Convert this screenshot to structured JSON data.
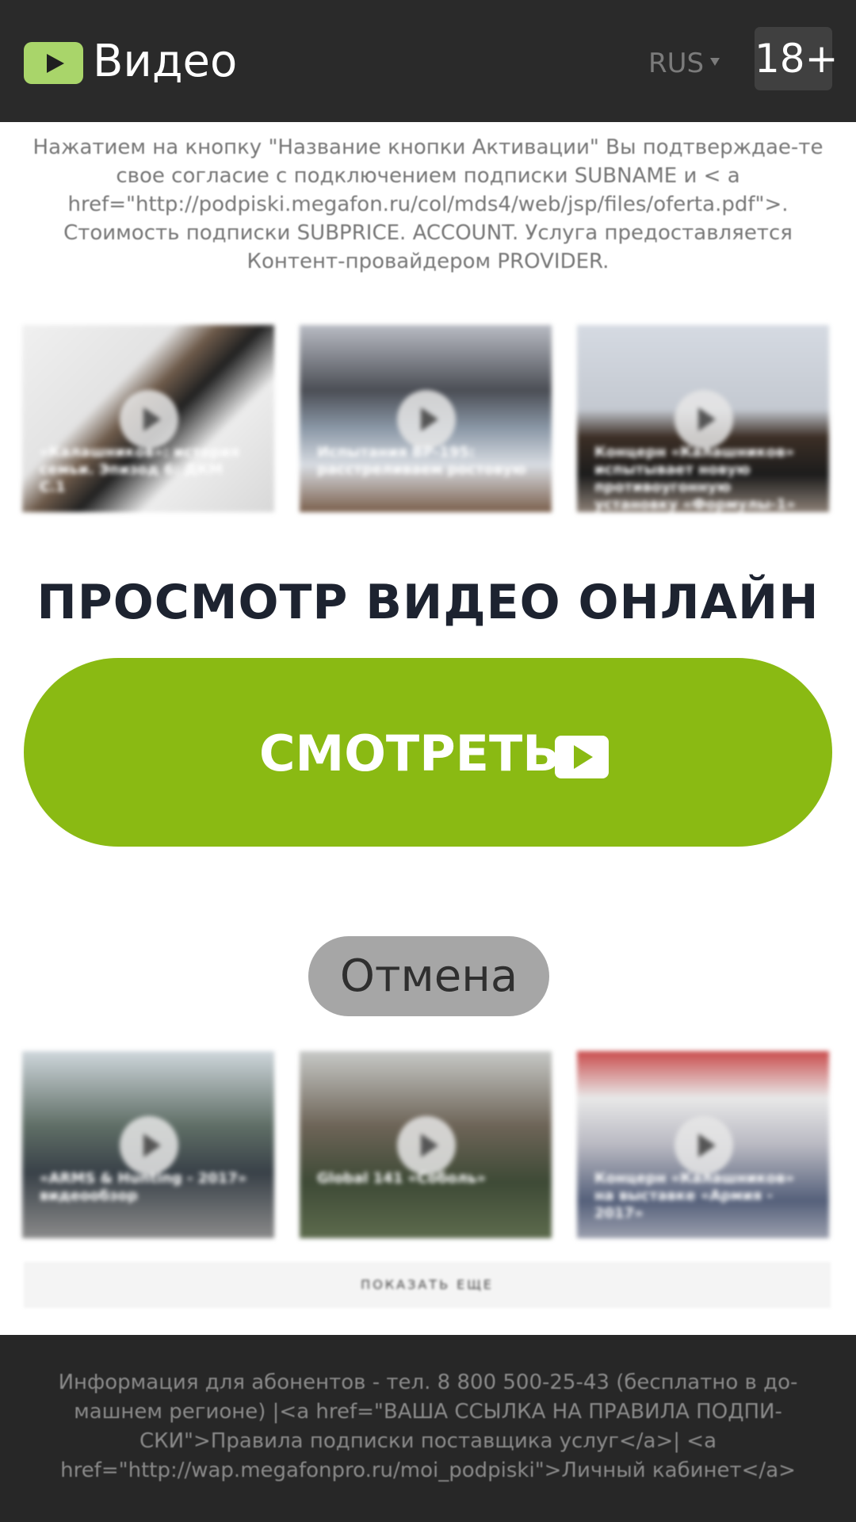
{
  "header": {
    "logo_icon": "play-icon",
    "title": "Видео",
    "language": "RUS",
    "age_badge": "18+"
  },
  "legal": {
    "text": "Нажатием на кнопку \"Название кнопки Активации\" Вы подтверждае-те свое согласие с подключением подписки SUBNAME и < a href=\"http://podpiski.megafon.ru/col/mds4/web/jsp/files/oferta.pdf\">. Стоимость подписки SUBPRICE. ACCOUNT. Услуга предоставляется Контент-провайдером PROVIDER."
  },
  "videos_top": [
    {
      "caption": "«Калашников»: история семьи. Эпизод 6: ДКМ С.1",
      "icon": "play-icon"
    },
    {
      "caption": "Испытания ВР-195: расстреливаем ростовую",
      "icon": "play-icon"
    },
    {
      "caption": "Концерн «Калашников» испытывает новую противоугонную установку «Формулы-1»",
      "icon": "play-icon"
    }
  ],
  "headline": "ПРОСМОТР ВИДЕО ОНЛАЙН",
  "watch_button": {
    "label": "СМОТРЕТЬ",
    "icon": "play-icon",
    "color": "#8aba13"
  },
  "cancel_button": {
    "label": "Отмена"
  },
  "videos_bottom": [
    {
      "caption": "«ARMS & Hunting - 2017» видеообзор",
      "icon": "play-icon"
    },
    {
      "caption": "Global 141 «Соболь»",
      "icon": "play-icon"
    },
    {
      "caption": "Концерн «Калашников» на выставке «Армия - 2017»",
      "icon": "play-icon"
    }
  ],
  "show_more": "ПОКАЗАТЬ ЕЩЕ",
  "footer": {
    "text": "Информация для абонентов - тел. 8 800 500-25-43 (бесплатно в до-машнем регионе) |<a href=\"ВАША ССЫЛКА НА ПРАВИЛА ПОДПИ-СКИ\">Правила подписки поставщика услуг</a>| <a href=\"http://wap.megafonpro.ru/moi_podpiski\">Личный кабинет</a>"
  }
}
